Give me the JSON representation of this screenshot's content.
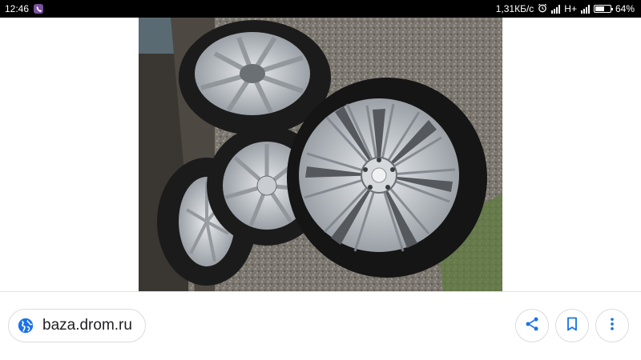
{
  "status_bar": {
    "time": "12:46",
    "notification_icon": "viber-icon",
    "network_speed": "1,31КБ/с",
    "network_type": "H+",
    "battery_percent": "64%",
    "battery_level": 0.64,
    "icons": [
      "alarm-icon",
      "signal-icon",
      "signal-icon",
      "battery-icon"
    ]
  },
  "image": {
    "subject": "photo-of-four-alloy-wheels-with-tires"
  },
  "source": {
    "domain": "baza.drom.ru",
    "icon": "globe-icon"
  },
  "actions": {
    "share_icon": "share-icon",
    "save_icon": "bookmark-icon",
    "more_icon": "more-vert-icon"
  },
  "colors": {
    "accent": "#1a73e8",
    "status_bar": "#000000",
    "chip_border": "#dadce0"
  }
}
